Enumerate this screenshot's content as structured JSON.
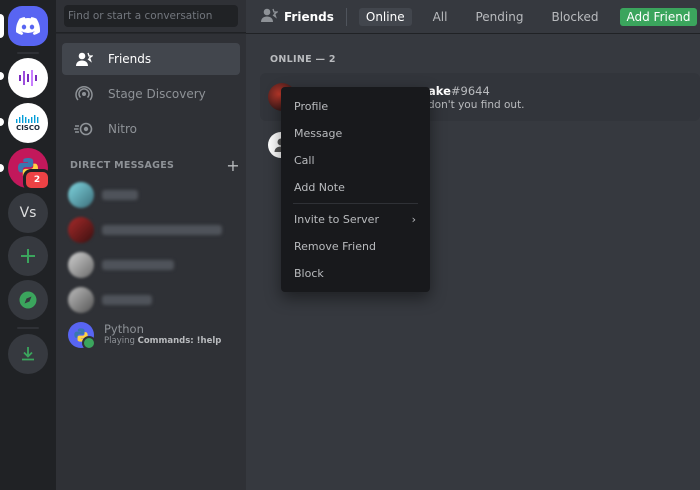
{
  "sidebar": {
    "search_placeholder": "Find or start a conversation",
    "nav": [
      {
        "label": "Friends",
        "icon": "friends-icon"
      },
      {
        "label": "Stage Discovery",
        "icon": "stage-icon"
      },
      {
        "label": "Nitro",
        "icon": "nitro-icon"
      }
    ],
    "dm_header": "DIRECT MESSAGES",
    "dm_add": "+",
    "python_dm": {
      "name": "Python",
      "status_prefix": "Playing ",
      "status_bold": "Commands: !help"
    }
  },
  "servers": {
    "vs_label": "Vs",
    "badge_count": "2",
    "cisco_label": "CISCO"
  },
  "topbar": {
    "title": "Friends",
    "tabs": [
      "Online",
      "All",
      "Pending",
      "Blocked"
    ],
    "add_friend": "Add Friend"
  },
  "main": {
    "online_header": "ONLINE — 2",
    "friend": {
      "name": "ake",
      "discriminator": "#9644",
      "status": "don't you find out."
    }
  },
  "context_menu": {
    "items_top": [
      "Profile",
      "Message",
      "Call",
      "Add Note"
    ],
    "items_bottom": [
      "Invite to Server",
      "Remove Friend",
      "Block"
    ]
  },
  "colors": {
    "blurple": "#5865f2",
    "green": "#3ba55d",
    "red": "#ed4245",
    "background": "#36393f"
  }
}
